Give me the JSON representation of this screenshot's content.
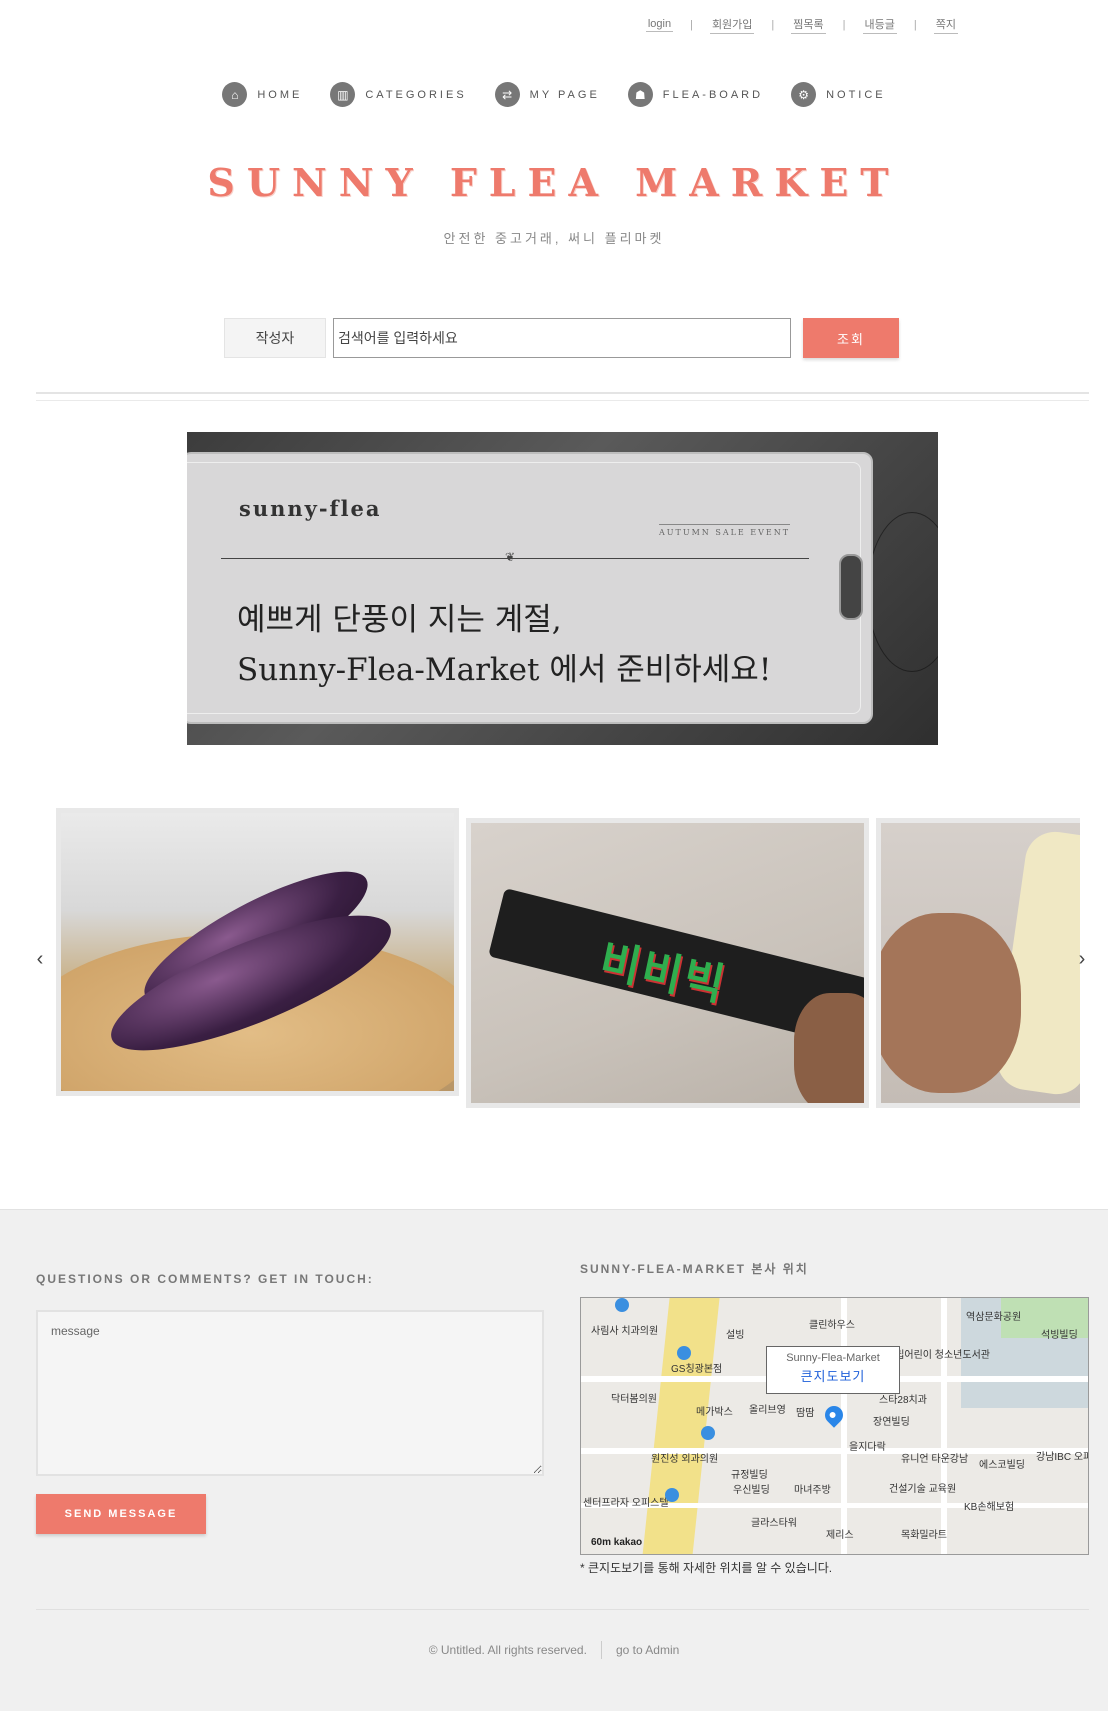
{
  "util_links": [
    "login",
    "회원가입",
    "찜목록",
    "내등글",
    "쪽지"
  ],
  "nav": [
    {
      "label": "HOME",
      "icon": "home-icon",
      "glyph": "⌂"
    },
    {
      "label": "CATEGORIES",
      "icon": "bar-chart-icon",
      "glyph": "▥"
    },
    {
      "label": "MY PAGE",
      "icon": "retweet-icon",
      "glyph": "⇄"
    },
    {
      "label": "FLEA-BOARD",
      "icon": "sitemap-icon",
      "glyph": "☗"
    },
    {
      "label": "NOTICE",
      "icon": "gear-icon",
      "glyph": "⚙"
    }
  ],
  "brand": {
    "title": "SUNNY FLEA MARKET",
    "tagline": "안전한 중고거래, 써니 플리마켓"
  },
  "search": {
    "select_value": "작성자",
    "placeholder": "검색어를 입력하세요",
    "button": "조회"
  },
  "banner": {
    "logo": "sunny-flea",
    "event": "AUTUMN SALE EVENT",
    "line1": "예쁘게 단풍이 지는 계절,",
    "line2": "Sunny-Flea-Market 에서 준비하세요!"
  },
  "carousel": {
    "prev": "‹",
    "next": "›",
    "bar_text": "비비빅"
  },
  "footer": {
    "questions_label": "QUESTIONS OR COMMENTS? GET IN TOUCH:",
    "message_placeholder": "message",
    "send_button": "SEND MESSAGE",
    "map_label": "SUNNY-FLEA-MARKET 본사 위치",
    "map_info_title": "Sunny-Flea-Market",
    "map_info_link": "큰지도보기",
    "map_note": "* 큰지도보기를 통해 자세한 위치를 알 수 있습니다.",
    "map_places": [
      "사림사 치과의원",
      "설빙",
      "클린하우스",
      "GS칭광본점",
      "국립어린이 청소년도서관",
      "역삼문화공원",
      "석빙빌딩",
      "닥터봄의원",
      "메가박스",
      "올리브영",
      "땀땀",
      "스타28치과",
      "장연빌딩",
      "을지다락",
      "유니언 타운강남",
      "에스코빌딩",
      "강남IBC 오피스텔",
      "원진성 외과의원",
      "규정빌딩",
      "우신빌딩",
      "마녀주방",
      "건설기술 교육원",
      "KB손해보험",
      "글라스타워",
      "제리스",
      "목화밀라트",
      "센터프라자 오피스텔",
      "kakao",
      "60m"
    ],
    "copyright": "© Untitled. All rights reserved.",
    "admin_link": "go to Admin"
  },
  "colors": {
    "accent": "#ee7a6c",
    "footer_bg": "#f0f0f0"
  }
}
